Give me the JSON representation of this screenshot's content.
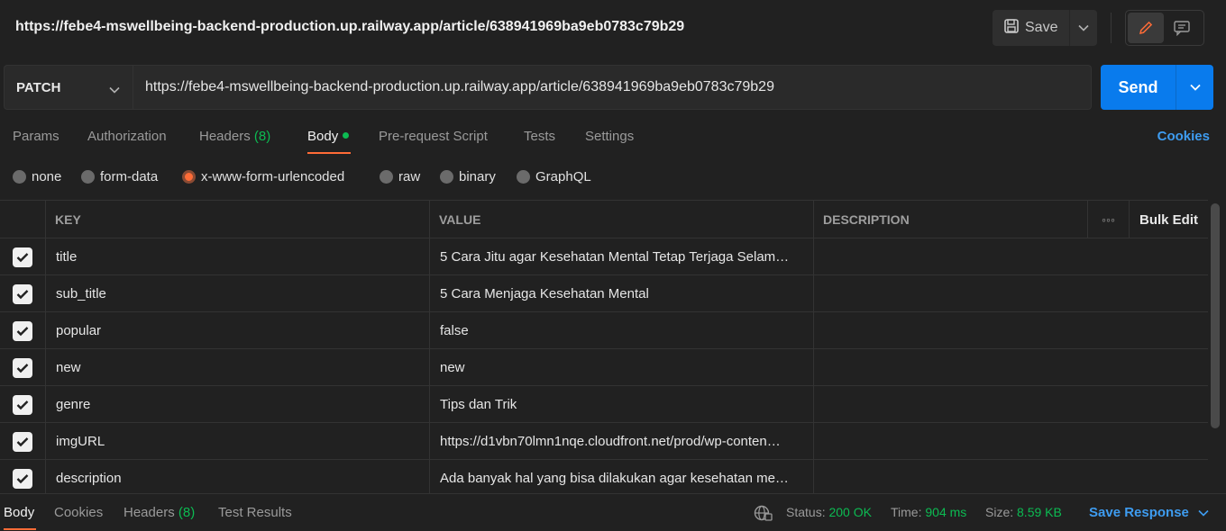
{
  "header": {
    "tab_title": "https://febe4-mswellbeing-backend-production.up.railway.app/article/638941969ba9eb0783c79b29",
    "save_label": "Save"
  },
  "request": {
    "method": "PATCH",
    "url": "https://febe4-mswellbeing-backend-production.up.railway.app/article/638941969ba9eb0783c79b29",
    "send_label": "Send"
  },
  "tabs": {
    "params": "Params",
    "authorization": "Authorization",
    "headers": "Headers",
    "headers_count": "(8)",
    "body": "Body",
    "prerequest": "Pre-request Script",
    "tests": "Tests",
    "settings": "Settings",
    "cookies": "Cookies"
  },
  "body_modes": {
    "none": "none",
    "form_data": "form-data",
    "urlencoded": "x-www-form-urlencoded",
    "raw": "raw",
    "binary": "binary",
    "graphql": "GraphQL",
    "selected": "x-www-form-urlencoded"
  },
  "table": {
    "headers": {
      "key": "KEY",
      "value": "VALUE",
      "description": "DESCRIPTION",
      "more": "◦◦◦",
      "bulk_edit": "Bulk Edit"
    },
    "rows": [
      {
        "key": "title",
        "value": "5 Cara Jitu agar Kesehatan Mental Tetap Terjaga Selam…",
        "description": ""
      },
      {
        "key": "sub_title",
        "value": "5 Cara Menjaga Kesehatan Mental",
        "description": ""
      },
      {
        "key": "popular",
        "value": "false",
        "description": ""
      },
      {
        "key": "new",
        "value": "new",
        "description": ""
      },
      {
        "key": "genre",
        "value": "Tips dan Trik",
        "description": ""
      },
      {
        "key": "imgURL",
        "value": "https://d1vbn70lmn1nqe.cloudfront.net/prod/wp-conten…",
        "description": ""
      },
      {
        "key": "description",
        "value": "Ada banyak hal yang bisa dilakukan agar kesehatan me…",
        "description": ""
      }
    ]
  },
  "footer": {
    "body": "Body",
    "cookies": "Cookies",
    "headers": "Headers",
    "headers_count": "(8)",
    "test_results": "Test Results",
    "status_label": "Status:",
    "status_value": "200 OK",
    "time_label": "Time:",
    "time_value": "904 ms",
    "size_label": "Size:",
    "size_value": "8.59 KB",
    "save_response": "Save Response"
  },
  "colors": {
    "accent": "#ff6c37",
    "send": "#097bed",
    "success": "#0cbb52",
    "link": "#3e9cf0"
  }
}
